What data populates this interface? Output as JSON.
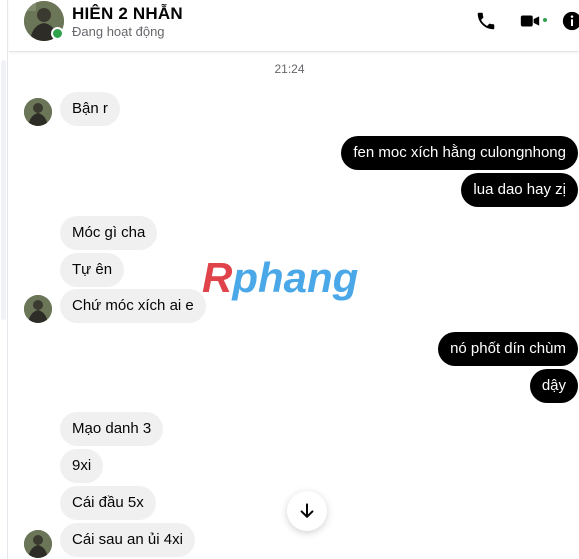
{
  "header": {
    "name": "HIÊN 2 NHẪN",
    "status": "Đang hoạt động",
    "icons": [
      "phone-icon",
      "video-camera-icon",
      "info-icon"
    ]
  },
  "timestamp": "21:24",
  "messages": [
    {
      "side": "in",
      "text": "Bận r"
    },
    {
      "side": "out",
      "text": "fen moc xích hằng culongnhong"
    },
    {
      "side": "out",
      "text": "lua dao hay zị"
    },
    {
      "side": "in",
      "text": "Móc gì cha"
    },
    {
      "side": "in",
      "text": "Tự ên"
    },
    {
      "side": "in",
      "text": "Chứ móc xích ai e"
    },
    {
      "side": "out",
      "text": "nó phốt dín chùm"
    },
    {
      "side": "out",
      "text": "dậy"
    },
    {
      "side": "in",
      "text": "Mạo danh 3"
    },
    {
      "side": "in",
      "text": "9xi"
    },
    {
      "side": "in",
      "text": "Cái đầu 5x"
    },
    {
      "side": "in",
      "text": "Cái sau an ủi 4xi"
    }
  ],
  "watermark": {
    "first": "R",
    "rest": "phang"
  },
  "colors": {
    "online": "#31a24c",
    "incoming_bubble": "#f0f0f0",
    "outgoing_bubble": "#000000"
  }
}
